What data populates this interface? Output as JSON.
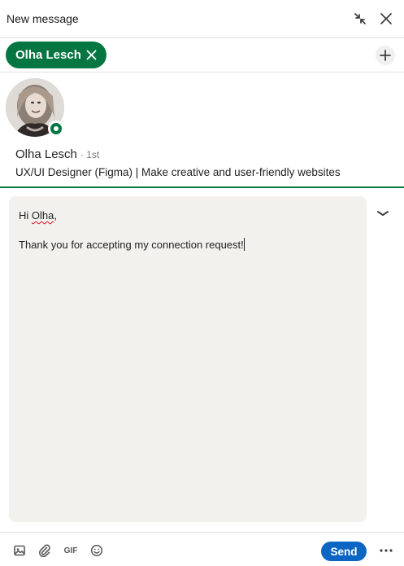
{
  "header": {
    "title": "New message",
    "minimize_icon": "minimize-arrows-icon",
    "close_icon": "close-icon"
  },
  "recipient": {
    "chip_label": "Olha Lesch",
    "remove_icon": "close-icon",
    "add_icon": "plus-icon"
  },
  "profile": {
    "name": "Olha Lesch",
    "degree": "· 1st",
    "headline": "UX/UI Designer (Figma) | Make creative and user-friendly websites",
    "presence": "online",
    "colors": {
      "accent": "#057642"
    }
  },
  "message": {
    "greeting_prefix": "Hi ",
    "greeting_name": "Olha",
    "greeting_suffix": ",",
    "body": "Thank you for accepting my connection request!"
  },
  "footer": {
    "image_icon": "image-icon",
    "attach_icon": "paperclip-icon",
    "gif_label": "GIF",
    "emoji_icon": "emoji-icon",
    "send_label": "Send",
    "more_icon": "more-icon",
    "colors": {
      "send": "#0a66c2"
    }
  }
}
